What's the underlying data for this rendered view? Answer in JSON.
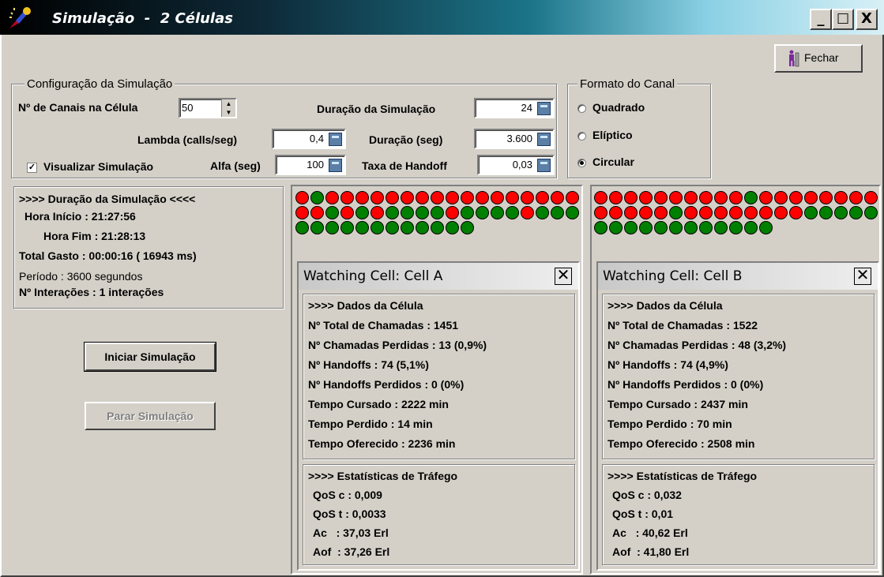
{
  "window": {
    "title": "Simulação  -  2 Células",
    "minimize": "_",
    "maximize": "□",
    "close": "X"
  },
  "toolbar": {
    "close_label": "Fechar"
  },
  "config": {
    "legend": "Configuração da Simulação",
    "channels_label": "Nº de Canais na Célula",
    "channels_value": "50",
    "duration_sim_label": "Duração da Simulação",
    "duration_sim_value": "24",
    "lambda_label": "Lambda (calls/seg)",
    "lambda_value": "0,4",
    "duration_sec_label": "Duração (seg)",
    "duration_sec_value": "3.600",
    "visualize_label": "Visualizar Simulação",
    "visualize_checked": true,
    "alfa_label": "Alfa (seg)",
    "alfa_value": "100",
    "handoff_label": "Taxa de Handoff",
    "handoff_value": "0,03"
  },
  "channel_format": {
    "legend": "Formato do Canal",
    "options": [
      "Quadrado",
      "Elíptico",
      "Circular"
    ],
    "selected": "Circular"
  },
  "duration_panel": {
    "title": ">>>> Duração da Simulação <<<<",
    "start": "Hora Início : 21:27:56",
    "end": "Hora Fim : 21:28:13",
    "total": "Total Gasto : 00:00:16 ( 16943 ms)",
    "period": "Período : 3600 segundos",
    "interactions": "Nº Interações : 1 interações"
  },
  "buttons": {
    "start": "Iniciar Simulação",
    "stop": "Parar Simulação"
  },
  "colors": {
    "busy": "#ff0000",
    "free": "#008000",
    "disabled_text": "#808080"
  },
  "cell_a": {
    "channels": [
      "red",
      "green",
      "red",
      "red",
      "red",
      "red",
      "red",
      "red",
      "red",
      "red",
      "red",
      "red",
      "red",
      "red",
      "red",
      "red",
      "red",
      "red",
      "red",
      "red",
      "red",
      "green",
      "red",
      "green",
      "red",
      "green",
      "green",
      "green",
      "green",
      "red",
      "green",
      "green",
      "green",
      "green",
      "red",
      "green",
      "green",
      "green",
      "green",
      "green",
      "green",
      "green",
      "green",
      "green",
      "green",
      "green",
      "green",
      "green",
      "green",
      "green"
    ],
    "watch_title": "Watching Cell: Cell A",
    "data_title": ">>>> Dados da Célula",
    "total_calls": "Nº Total de Chamadas : 1451",
    "lost_calls": "Nº Chamadas Perdidas : 13 (0,9%)",
    "handoffs": "Nº Handoffs : 74 (5,1%)",
    "lost_handoffs": "Nº Handoffs Perdidos : 0 (0%)",
    "time_carried": "Tempo Cursado : 2222 min",
    "time_lost": "Tempo Perdido : 14 min",
    "time_offered": "Tempo Oferecido : 2236 min",
    "stats_title": ">>>> Estatísticas de Tráfego",
    "qos_c": "QoS c : 0,009",
    "qos_t": "QoS t : 0,0033",
    "ac": "Ac   : 37,03 Erl",
    "aof": "Aof  : 37,26 Erl"
  },
  "cell_b": {
    "channels": [
      "red",
      "red",
      "red",
      "red",
      "red",
      "red",
      "red",
      "red",
      "red",
      "red",
      "green",
      "red",
      "red",
      "red",
      "red",
      "red",
      "red",
      "red",
      "red",
      "red",
      "red",
      "red",
      "red",
      "red",
      "green",
      "red",
      "red",
      "red",
      "red",
      "red",
      "red",
      "red",
      "red",
      "green",
      "green",
      "green",
      "green",
      "green",
      "green",
      "green",
      "green",
      "green",
      "green",
      "green",
      "green",
      "green",
      "green",
      "green",
      "green",
      "green"
    ],
    "watch_title": "Watching Cell: Cell B",
    "data_title": ">>>> Dados da Célula",
    "total_calls": "Nº Total de Chamadas : 1522",
    "lost_calls": "Nº Chamadas Perdidas : 48 (3,2%)",
    "handoffs": "Nº Handoffs : 74 (4,9%)",
    "lost_handoffs": "Nº Handoffs Perdidos : 0 (0%)",
    "time_carried": "Tempo Cursado : 2437 min",
    "time_lost": "Tempo Perdido : 70 min",
    "time_offered": "Tempo Oferecido : 2508 min",
    "stats_title": ">>>> Estatísticas de Tráfego",
    "qos_c": "QoS c : 0,032",
    "qos_t": "QoS t : 0,01",
    "ac": "Ac   : 40,62 Erl",
    "aof": "Aof  : 41,80 Erl"
  }
}
